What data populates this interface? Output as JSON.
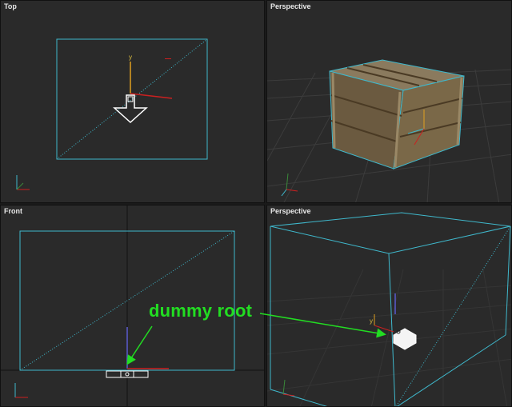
{
  "viewports": {
    "top": {
      "label": "Top"
    },
    "persp_top": {
      "label": "Perspective"
    },
    "front": {
      "label": "Front"
    },
    "persp_bottom": {
      "label": "Perspective"
    }
  },
  "gizmo": {
    "y_label": "y"
  },
  "annotation": {
    "text": "dummy root"
  },
  "colors": {
    "viewport_bg": "#2a2a2a",
    "wireframe": "#3fb8cc",
    "gizmo_y": "#e0a020",
    "gizmo_x": "#cc2020",
    "annotation": "#22dd22"
  },
  "icons": {
    "crate": "wooden-crate",
    "dummy": "dummy-helper-icon",
    "axis_tripod": "axis-tripod-icon"
  }
}
